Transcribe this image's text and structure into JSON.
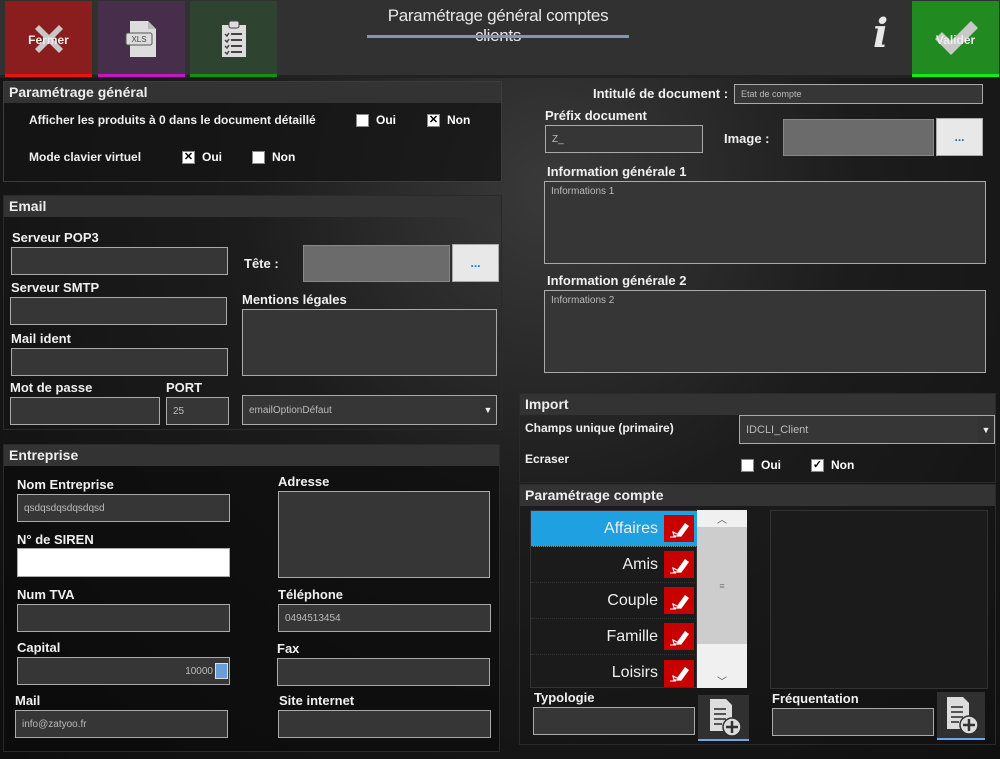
{
  "toolbar": {
    "close_label": "Fermer",
    "xls_icon_text": "XLS",
    "title": "Paramétrage général comptes clients",
    "info_glyph": "i",
    "validate_label": "Valider"
  },
  "general": {
    "header": "Paramétrage général",
    "show_zero_products": {
      "label": "Afficher les produits à 0 dans le document détaillé",
      "oui": {
        "label": "Oui",
        "checked": false,
        "mark": ""
      },
      "non": {
        "label": "Non",
        "checked": true,
        "mark": "✕"
      }
    },
    "virtual_keyboard": {
      "label": "Mode clavier virtuel",
      "oui": {
        "label": "Oui",
        "checked": true,
        "mark": "✕"
      },
      "non": {
        "label": "Non",
        "checked": false,
        "mark": ""
      }
    }
  },
  "email": {
    "header": "Email",
    "pop3_label": "Serveur POP3",
    "pop3_value": "",
    "smtp_label": "Serveur SMTP",
    "smtp_value": "",
    "mail_ident_label": "Mail ident",
    "mail_ident_value": "",
    "password_label": "Mot de passe",
    "password_value": "",
    "port_label": "PORT",
    "port_value": "25",
    "tete_label": "Tête :",
    "tete_button": "...",
    "mentions_label": "Mentions légales",
    "mentions_value": "",
    "option_select": "emailOptionDéfaut"
  },
  "company": {
    "header": "Entreprise",
    "name_label": "Nom Entreprise",
    "name_value": "qsdqsdqsdqsdqsd",
    "siren_label": "N° de SIREN",
    "siren_value": "",
    "tva_label": "Num TVA",
    "tva_value": "",
    "capital_label": "Capital",
    "capital_value": "10000",
    "mail_label": "Mail",
    "mail_value": "info@zatyoo.fr",
    "address_label": "Adresse",
    "address_value": "",
    "phone_label": "Téléphone",
    "phone_value": "0494513454",
    "fax_label": "Fax",
    "fax_value": "",
    "website_label": "Site internet",
    "website_value": ""
  },
  "document": {
    "title_label": "Intitulé de document :",
    "title_value": "Etat de compte",
    "prefix_label": "Préfix document",
    "prefix_value": "Z_",
    "image_label": "Image :",
    "image_button": "...",
    "info1_label": "Information générale 1",
    "info1_value": "Informations 1",
    "info2_label": "Information générale 2",
    "info2_value": "Informations 2"
  },
  "import": {
    "header": "Import",
    "unique_field_label": "Champs unique (primaire)",
    "unique_field_value": "IDCLI_Client",
    "overwrite_label": "Ecraser",
    "oui": {
      "label": "Oui",
      "checked": false,
      "mark": ""
    },
    "non": {
      "label": "Non",
      "checked": true,
      "mark": "✓"
    }
  },
  "account": {
    "header": "Paramétrage compte",
    "typologies": [
      {
        "name": "Affaires",
        "selected": true
      },
      {
        "name": "Amis",
        "selected": false
      },
      {
        "name": "Couple",
        "selected": false
      },
      {
        "name": "Famille",
        "selected": false
      },
      {
        "name": "Loisirs",
        "selected": false
      }
    ],
    "typologie_label": "Typologie",
    "typologie_value": "",
    "frequentation_label": "Fréquentation",
    "frequentation_value": ""
  }
}
